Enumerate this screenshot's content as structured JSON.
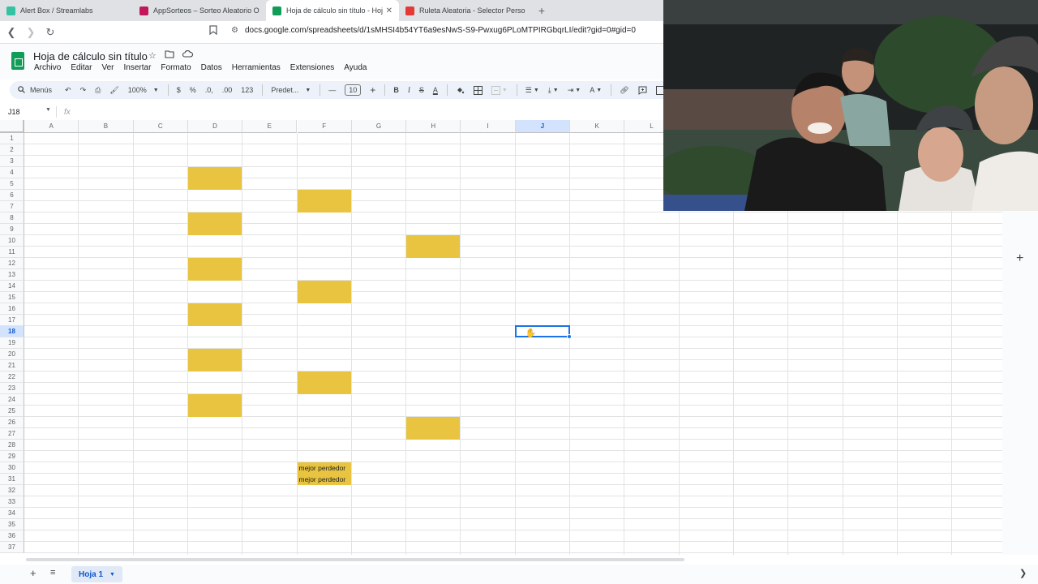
{
  "browser": {
    "tabs": [
      {
        "title": "Alert Box / Streamlabs",
        "favicon_color": "#31c3a2",
        "active": false
      },
      {
        "title": "AppSorteos – Sorteo Aleatorio On",
        "favicon_color": "#c2185b",
        "active": false
      },
      {
        "title": "Hoja de cálculo sin título - Hoj",
        "favicon_color": "#0f9d58",
        "active": true
      },
      {
        "title": "Ruleta Aleatoria - Selector Persona",
        "favicon_color": "#e53935",
        "active": false
      }
    ],
    "new_tab": "+",
    "close_tab": "✕",
    "url": "docs.google.com/spreadsheets/d/1sMHSI4b54YT6a9esNwS-S9-Pwxug6PLoMTPIRGbqrLI/edit?gid=0#gid=0"
  },
  "doc": {
    "title": "Hoja de cálculo sin título",
    "menu": [
      "Archivo",
      "Editar",
      "Ver",
      "Insertar",
      "Formato",
      "Datos",
      "Herramientas",
      "Extensiones",
      "Ayuda"
    ]
  },
  "toolbar": {
    "search": "Menús",
    "zoom": "100%",
    "currency": "$",
    "percent": "%",
    "dec_less": ".0,",
    "dec_more": ".00",
    "format_num": "123",
    "font": "Predet...",
    "font_size": "10",
    "bold": "B",
    "italic": "I",
    "strike": "S",
    "text_color": "A"
  },
  "formula_bar": {
    "name_box": "J18",
    "fx": "fx"
  },
  "grid": {
    "columns": [
      "A",
      "B",
      "C",
      "D",
      "E",
      "F",
      "G",
      "H",
      "I",
      "J",
      "K",
      "L",
      "",
      "",
      "",
      "",
      "",
      ""
    ],
    "selected_column": "J",
    "row_count": 37,
    "selected_row": 18,
    "fill_color": "#e8c440",
    "filled_cells": [
      {
        "col": "D",
        "rows": [
          4,
          5
        ]
      },
      {
        "col": "F",
        "rows": [
          6,
          7
        ]
      },
      {
        "col": "D",
        "rows": [
          8,
          9
        ]
      },
      {
        "col": "H",
        "rows": [
          10,
          11
        ]
      },
      {
        "col": "D",
        "rows": [
          12,
          13
        ]
      },
      {
        "col": "F",
        "rows": [
          14,
          15
        ]
      },
      {
        "col": "D",
        "rows": [
          16,
          17
        ]
      },
      {
        "col": "D",
        "rows": [
          20,
          21
        ]
      },
      {
        "col": "F",
        "rows": [
          22,
          23
        ]
      },
      {
        "col": "D",
        "rows": [
          24,
          25
        ]
      },
      {
        "col": "H",
        "rows": [
          26,
          27
        ]
      }
    ],
    "text_cells": [
      {
        "col": "F",
        "row": 30,
        "text": "mejor perdedor"
      },
      {
        "col": "F",
        "row": 31,
        "text": "mejor perdedor"
      }
    ]
  },
  "sheets": {
    "add": "+",
    "list": "≡",
    "active_sheet": "Hoja 1"
  }
}
